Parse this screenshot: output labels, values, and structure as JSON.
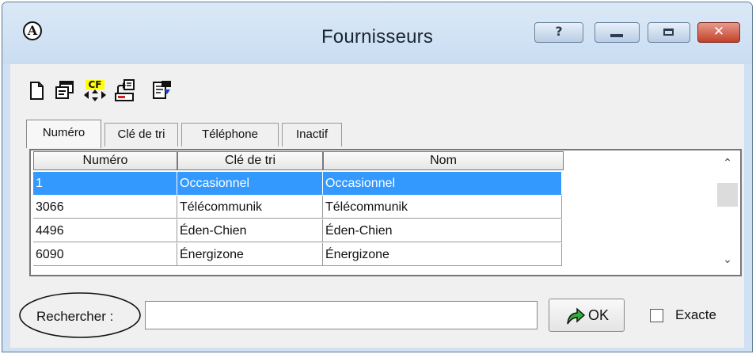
{
  "window": {
    "title": "Fournisseurs",
    "app_icon_glyph": "A",
    "help_glyph": "?",
    "close_glyph": "✕"
  },
  "toolbar": {
    "buttons": [
      {
        "name": "new-document-icon"
      },
      {
        "name": "edit-window-icon"
      },
      {
        "name": "sort-key-icon",
        "label": "CF"
      },
      {
        "name": "export-icon"
      },
      {
        "name": "properties-icon"
      }
    ]
  },
  "tabs": [
    {
      "label": "Numéro",
      "active": true
    },
    {
      "label": "Clé de tri",
      "active": false
    },
    {
      "label": "Téléphone",
      "active": false
    },
    {
      "label": "Inactif",
      "active": false
    }
  ],
  "grid": {
    "columns": [
      "Numéro",
      "Clé de tri",
      "Nom"
    ],
    "rows": [
      [
        "1",
        "Occasionnel",
        "Occasionnel"
      ],
      [
        "3066",
        "Télécommunik",
        "Télécommunik"
      ],
      [
        "4496",
        "Éden-Chien",
        "Éden-Chien"
      ],
      [
        "6090",
        "Énergizone",
        "Énergizone"
      ]
    ],
    "selected_row": 0
  },
  "search": {
    "label": "Rechercher :",
    "value": "",
    "placeholder": ""
  },
  "ok_button": {
    "label": "OK"
  },
  "exact": {
    "label": "Exacte",
    "checked": false
  },
  "colors": {
    "selection": "#3399ff",
    "title_bar": "#cfe1f3",
    "close_button": "#c2412b"
  }
}
